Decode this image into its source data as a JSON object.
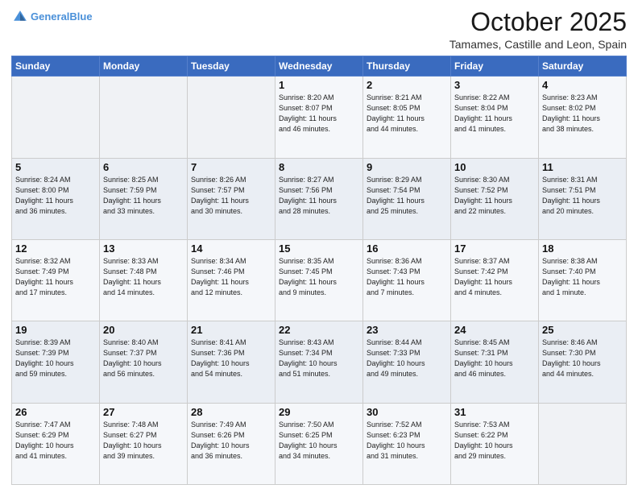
{
  "header": {
    "logo_line1": "General",
    "logo_line2": "Blue",
    "month": "October 2025",
    "location": "Tamames, Castille and Leon, Spain"
  },
  "days_of_week": [
    "Sunday",
    "Monday",
    "Tuesday",
    "Wednesday",
    "Thursday",
    "Friday",
    "Saturday"
  ],
  "weeks": [
    [
      {
        "day": "",
        "info": ""
      },
      {
        "day": "",
        "info": ""
      },
      {
        "day": "",
        "info": ""
      },
      {
        "day": "1",
        "info": "Sunrise: 8:20 AM\nSunset: 8:07 PM\nDaylight: 11 hours\nand 46 minutes."
      },
      {
        "day": "2",
        "info": "Sunrise: 8:21 AM\nSunset: 8:05 PM\nDaylight: 11 hours\nand 44 minutes."
      },
      {
        "day": "3",
        "info": "Sunrise: 8:22 AM\nSunset: 8:04 PM\nDaylight: 11 hours\nand 41 minutes."
      },
      {
        "day": "4",
        "info": "Sunrise: 8:23 AM\nSunset: 8:02 PM\nDaylight: 11 hours\nand 38 minutes."
      }
    ],
    [
      {
        "day": "5",
        "info": "Sunrise: 8:24 AM\nSunset: 8:00 PM\nDaylight: 11 hours\nand 36 minutes."
      },
      {
        "day": "6",
        "info": "Sunrise: 8:25 AM\nSunset: 7:59 PM\nDaylight: 11 hours\nand 33 minutes."
      },
      {
        "day": "7",
        "info": "Sunrise: 8:26 AM\nSunset: 7:57 PM\nDaylight: 11 hours\nand 30 minutes."
      },
      {
        "day": "8",
        "info": "Sunrise: 8:27 AM\nSunset: 7:56 PM\nDaylight: 11 hours\nand 28 minutes."
      },
      {
        "day": "9",
        "info": "Sunrise: 8:29 AM\nSunset: 7:54 PM\nDaylight: 11 hours\nand 25 minutes."
      },
      {
        "day": "10",
        "info": "Sunrise: 8:30 AM\nSunset: 7:52 PM\nDaylight: 11 hours\nand 22 minutes."
      },
      {
        "day": "11",
        "info": "Sunrise: 8:31 AM\nSunset: 7:51 PM\nDaylight: 11 hours\nand 20 minutes."
      }
    ],
    [
      {
        "day": "12",
        "info": "Sunrise: 8:32 AM\nSunset: 7:49 PM\nDaylight: 11 hours\nand 17 minutes."
      },
      {
        "day": "13",
        "info": "Sunrise: 8:33 AM\nSunset: 7:48 PM\nDaylight: 11 hours\nand 14 minutes."
      },
      {
        "day": "14",
        "info": "Sunrise: 8:34 AM\nSunset: 7:46 PM\nDaylight: 11 hours\nand 12 minutes."
      },
      {
        "day": "15",
        "info": "Sunrise: 8:35 AM\nSunset: 7:45 PM\nDaylight: 11 hours\nand 9 minutes."
      },
      {
        "day": "16",
        "info": "Sunrise: 8:36 AM\nSunset: 7:43 PM\nDaylight: 11 hours\nand 7 minutes."
      },
      {
        "day": "17",
        "info": "Sunrise: 8:37 AM\nSunset: 7:42 PM\nDaylight: 11 hours\nand 4 minutes."
      },
      {
        "day": "18",
        "info": "Sunrise: 8:38 AM\nSunset: 7:40 PM\nDaylight: 11 hours\nand 1 minute."
      }
    ],
    [
      {
        "day": "19",
        "info": "Sunrise: 8:39 AM\nSunset: 7:39 PM\nDaylight: 10 hours\nand 59 minutes."
      },
      {
        "day": "20",
        "info": "Sunrise: 8:40 AM\nSunset: 7:37 PM\nDaylight: 10 hours\nand 56 minutes."
      },
      {
        "day": "21",
        "info": "Sunrise: 8:41 AM\nSunset: 7:36 PM\nDaylight: 10 hours\nand 54 minutes."
      },
      {
        "day": "22",
        "info": "Sunrise: 8:43 AM\nSunset: 7:34 PM\nDaylight: 10 hours\nand 51 minutes."
      },
      {
        "day": "23",
        "info": "Sunrise: 8:44 AM\nSunset: 7:33 PM\nDaylight: 10 hours\nand 49 minutes."
      },
      {
        "day": "24",
        "info": "Sunrise: 8:45 AM\nSunset: 7:31 PM\nDaylight: 10 hours\nand 46 minutes."
      },
      {
        "day": "25",
        "info": "Sunrise: 8:46 AM\nSunset: 7:30 PM\nDaylight: 10 hours\nand 44 minutes."
      }
    ],
    [
      {
        "day": "26",
        "info": "Sunrise: 7:47 AM\nSunset: 6:29 PM\nDaylight: 10 hours\nand 41 minutes."
      },
      {
        "day": "27",
        "info": "Sunrise: 7:48 AM\nSunset: 6:27 PM\nDaylight: 10 hours\nand 39 minutes."
      },
      {
        "day": "28",
        "info": "Sunrise: 7:49 AM\nSunset: 6:26 PM\nDaylight: 10 hours\nand 36 minutes."
      },
      {
        "day": "29",
        "info": "Sunrise: 7:50 AM\nSunset: 6:25 PM\nDaylight: 10 hours\nand 34 minutes."
      },
      {
        "day": "30",
        "info": "Sunrise: 7:52 AM\nSunset: 6:23 PM\nDaylight: 10 hours\nand 31 minutes."
      },
      {
        "day": "31",
        "info": "Sunrise: 7:53 AM\nSunset: 6:22 PM\nDaylight: 10 hours\nand 29 minutes."
      },
      {
        "day": "",
        "info": ""
      }
    ]
  ]
}
